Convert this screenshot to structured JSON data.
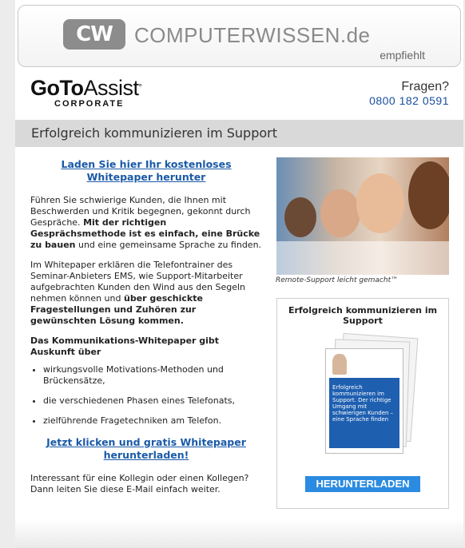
{
  "header": {
    "logo_text": "CW",
    "brand": "COMPUTERWISSEN.de",
    "recommends": "empfiehlt"
  },
  "goto": {
    "name_bold": "GoTo",
    "name_light": "Assist",
    "sub": "CORPORATE",
    "question": "Fragen?",
    "phone": "0800 182 0591"
  },
  "title": "Erfolgreich kommunizieren im Support",
  "content": {
    "cta_top": "Laden Sie hier Ihr kostenloses Whitepaper herunter",
    "p1_a": "Führen Sie schwierige Kunden, die Ihnen mit Beschwerden und Kritik begegnen, gekonnt durch Gespräche. ",
    "p1_b": "Mit der richtigen Gesprächsmethode ist es einfach, eine Brücke zu bauen",
    "p1_c": " und eine gemeinsame Sprache zu finden.",
    "p2_a": "Im Whitepaper erklären die Telefontrainer des Seminar-Anbieters EMS, wie Support-Mitarbeiter aufgebrachten Kunden den Wind aus den Segeln nehmen können und ",
    "p2_b": "über geschickte Fragestellungen und Zuhören zur gewünschten Lösung kommen.",
    "list_heading": "Das Kommunikations-Whitepaper gibt Auskunft über",
    "bullets": [
      "wirkungsvolle Motivations-Methoden und Brückensätze,",
      "die verschiedenen Phasen eines Telefonats,",
      "zielführende Fragetechniken am Telefon."
    ],
    "cta_bottom": "Jetzt klicken und gratis Whitepaper herunterladen!",
    "closing": "Interessant für eine Kollegin oder einen Kollegen? Dann leiten Sie diese E-Mail einfach weiter."
  },
  "sidebar": {
    "caption": "Remote-Support leicht gemacht™",
    "promo_title": "Erfolgreich kommunizieren im Support",
    "cover_text": "Erfolgreich kommunizieren im Support. Der richtige Umgang mit schwierigen Kunden – eine Sprache finden",
    "button": "HERUNTERLADEN"
  }
}
